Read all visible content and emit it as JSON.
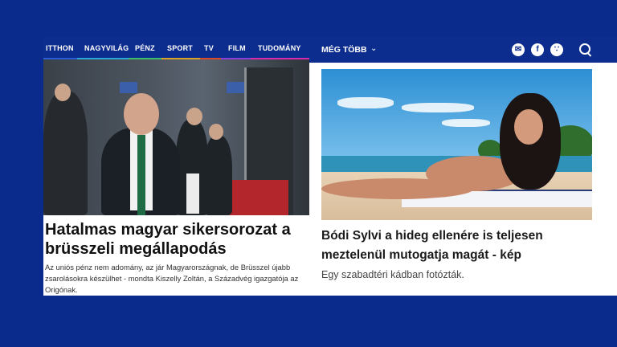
{
  "left_nav": {
    "items": [
      {
        "label": "ITTHON",
        "color": "#2a5bd7"
      },
      {
        "label": "NAGYVILÁG",
        "color": "#2aa6d7"
      },
      {
        "label": "PÉNZ",
        "color": "#3dbd6b"
      },
      {
        "label": "SPORT",
        "color": "#d7a12a"
      },
      {
        "label": "TV",
        "color": "#d74a2a"
      },
      {
        "label": "FILM",
        "color": "#8b3dd7"
      },
      {
        "label": "TUDOMÁNY",
        "color": "#d72ab0"
      }
    ]
  },
  "left_article": {
    "headline": "Hatalmas magyar sikersorozat a brüsszeli megállapodás",
    "lead": "Az uniós pénz nem adomány, az jár Magyarországnak, de Brüsszel újabb zsarolásokra készülhet - mondta Kiszelly Zoltán, a Századvég igazgatója az Origónak."
  },
  "right_nav": {
    "more_label": "MÉG TÖBB",
    "chevron_icon": "chevron-down-icon",
    "icons": [
      "mail-icon",
      "facebook-icon",
      "rss-icon",
      "search-icon"
    ],
    "facebook_glyph": "f"
  },
  "right_article": {
    "headline": "Bódi Sylvi a hideg ellenére is teljesen meztelenül mutogatja magát - kép",
    "lead": "Egy szabadtéri kádban fotózták."
  },
  "colors": {
    "background": "#0a2a8c",
    "nav": "#0d2d8e",
    "panel": "#ffffff"
  }
}
